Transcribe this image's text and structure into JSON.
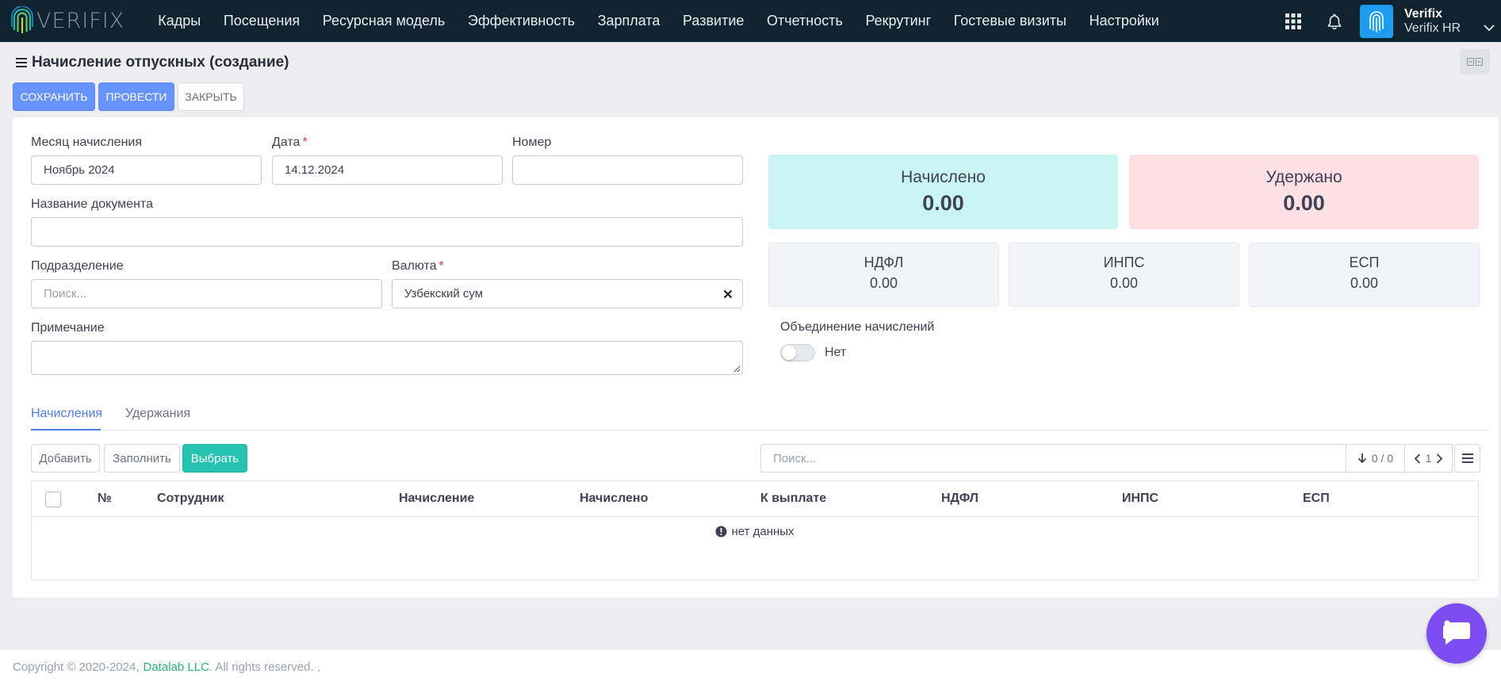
{
  "app": {
    "logo_text": "VERIFIX",
    "nav": [
      "Кадры",
      "Посещения",
      "Ресурсная модель",
      "Эффективность",
      "Зарплата",
      "Развитие",
      "Отчетность",
      "Рекрутинг",
      "Гостевые визиты",
      "Настройки"
    ],
    "user_name": "Verifix",
    "user_org": "Verifix HR"
  },
  "page": {
    "title": "Начисление отпускных (создание)"
  },
  "actions": {
    "save": "СОХРАНИТЬ",
    "post": "ПРОВЕСТИ",
    "close": "ЗАКРЫТЬ"
  },
  "form": {
    "month_label": "Месяц начисления",
    "month_value": "Ноябрь 2024",
    "date_label": "Дата",
    "date_value": "14.12.2024",
    "number_label": "Номер",
    "number_value": "",
    "doc_name_label": "Название документа",
    "doc_name_value": "",
    "division_label": "Подразделение",
    "division_placeholder": "Поиск...",
    "currency_label": "Валюта",
    "currency_value": "Узбекский сум",
    "note_label": "Примечание",
    "required_mark": "*",
    "merge_label": "Объединение начислений",
    "merge_value": "Нет"
  },
  "summary": {
    "accrued_label": "Начислено",
    "accrued_value": "0.00",
    "withheld_label": "Удержано",
    "withheld_value": "0.00",
    "ndfl_label": "НДФЛ",
    "ndfl_value": "0.00",
    "inps_label": "ИНПС",
    "inps_value": "0.00",
    "esp_label": "ЕСП",
    "esp_value": "0.00",
    "accrued_color": "#c9f4f1",
    "withheld_color": "#fde0e4"
  },
  "tabs": [
    "Начисления",
    "Удержания"
  ],
  "table_toolbar": {
    "add": "Добавить",
    "fill": "Заполнить",
    "select": "Выбрать",
    "search_placeholder": "Поиск...",
    "count": "0 / 0",
    "page": "1"
  },
  "table": {
    "columns": [
      "№",
      "Сотрудник",
      "Начисление",
      "Начислено",
      "К выплате",
      "НДФЛ",
      "ИНПС",
      "ЕСП"
    ],
    "empty_text": "нет данных"
  },
  "footer": {
    "copyright": "Copyright © 2020-2024,",
    "company": "Datalab LLC",
    "rights": ". All rights reserved. ,"
  },
  "icons": [
    "logo-fingerprint-icon",
    "apps-grid-icon",
    "bell-icon",
    "fingerprint-icon",
    "chevron-down-icon",
    "menu-icon",
    "layout-toggle-icon",
    "close-icon",
    "resize-grip-icon",
    "sort-down-icon",
    "chevron-left-icon",
    "chevron-right-icon",
    "list-menu-icon",
    "info-icon",
    "chat-icon"
  ]
}
